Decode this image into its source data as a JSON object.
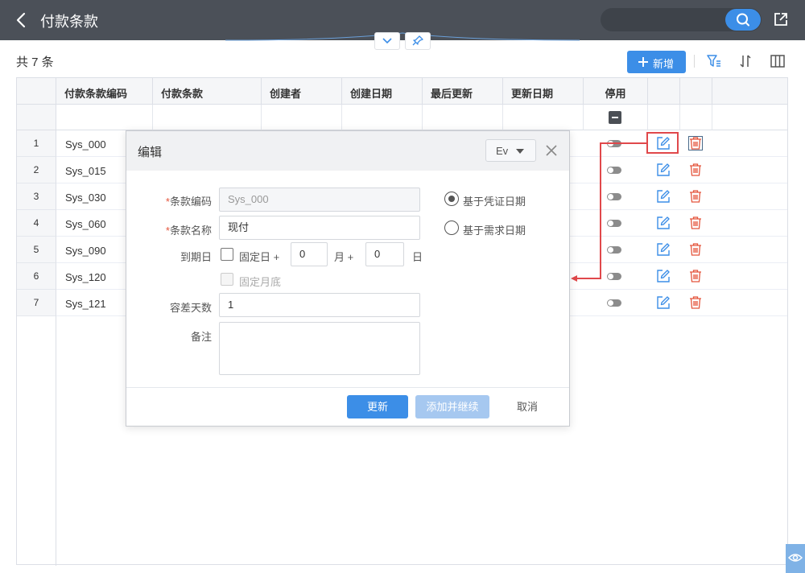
{
  "header": {
    "title": "付款条款",
    "search_placeholder": ""
  },
  "toolbar": {
    "count_label": "共 7 条",
    "add_label": "新增"
  },
  "table": {
    "columns": [
      "付款条款编码",
      "付款条款",
      "创建者",
      "创建日期",
      "最后更新",
      "更新日期",
      "停用"
    ],
    "rows": [
      {
        "n": "1",
        "code": "Sys_000"
      },
      {
        "n": "2",
        "code": "Sys_015"
      },
      {
        "n": "3",
        "code": "Sys_030"
      },
      {
        "n": "4",
        "code": "Sys_060"
      },
      {
        "n": "5",
        "code": "Sys_090"
      },
      {
        "n": "6",
        "code": "Sys_120"
      },
      {
        "n": "7",
        "code": "Sys_121"
      }
    ]
  },
  "dialog": {
    "title": "编辑",
    "lang": "Ev",
    "fields": {
      "code_label": "条款编码",
      "code_value": "Sys_000",
      "name_label": "条款名称",
      "name_value": "现付",
      "due_label": "到期日",
      "fixed_day_label": "固定日 +",
      "month_value": "0",
      "month_label": "月 +",
      "day_value": "0",
      "day_label": "日",
      "month_end_label": "固定月底",
      "tolerance_label": "容差天数",
      "tolerance_value": "1",
      "remark_label": "备注",
      "remark_value": ""
    },
    "radio": {
      "opt1": "基于凭证日期",
      "opt2": "基于需求日期",
      "selected": "opt1"
    },
    "buttons": {
      "update": "更新",
      "add_continue": "添加并继续",
      "cancel": "取消"
    }
  },
  "colors": {
    "accent": "#3c8ee7",
    "header_bg": "#4b5058",
    "danger": "#e4553c",
    "annotation": "#e0484b"
  }
}
